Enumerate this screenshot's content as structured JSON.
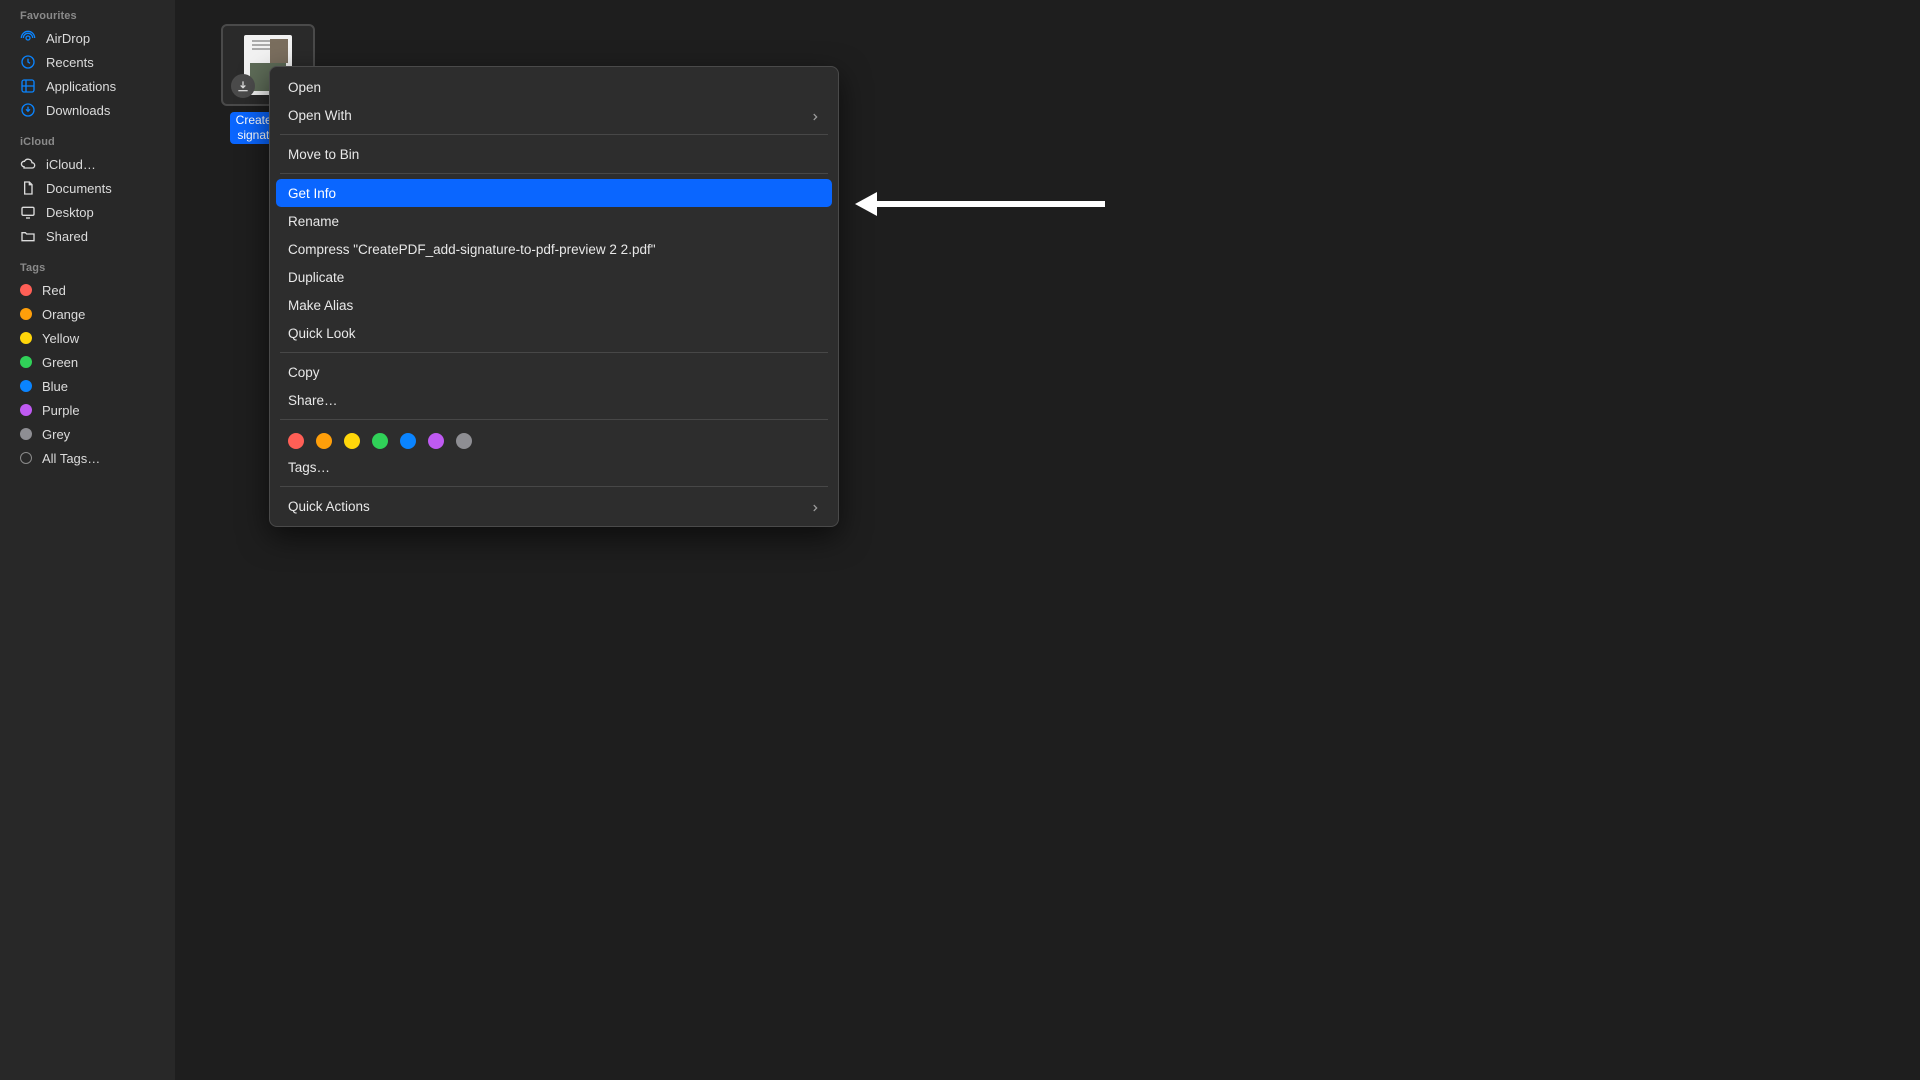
{
  "sidebar": {
    "sections": {
      "favourites": {
        "title": "Favourites",
        "items": [
          {
            "label": "AirDrop"
          },
          {
            "label": "Recents"
          },
          {
            "label": "Applications"
          },
          {
            "label": "Downloads"
          }
        ]
      },
      "icloud": {
        "title": "iCloud",
        "items": [
          {
            "label": "iCloud…"
          },
          {
            "label": "Documents"
          },
          {
            "label": "Desktop"
          },
          {
            "label": "Shared"
          }
        ]
      },
      "tags": {
        "title": "Tags",
        "items": [
          {
            "label": "Red",
            "color": "#ff5f56"
          },
          {
            "label": "Orange",
            "color": "#ff9f0a"
          },
          {
            "label": "Yellow",
            "color": "#ffd60a"
          },
          {
            "label": "Green",
            "color": "#30d158"
          },
          {
            "label": "Blue",
            "color": "#0a84ff"
          },
          {
            "label": "Purple",
            "color": "#bf5af2"
          },
          {
            "label": "Grey",
            "color": "#8e8e93"
          }
        ],
        "all_tags": "All Tags…"
      }
    }
  },
  "file": {
    "name": "CreatePD…\nsignature…"
  },
  "context_menu": {
    "open": "Open",
    "open_with": "Open With",
    "move_to_bin": "Move to Bin",
    "get_info": "Get Info",
    "rename": "Rename",
    "compress": "Compress \"CreatePDF_add-signature-to-pdf-preview 2 2.pdf\"",
    "duplicate": "Duplicate",
    "make_alias": "Make Alias",
    "quick_look": "Quick Look",
    "copy": "Copy",
    "share": "Share…",
    "tags_button": "Tags…",
    "quick_actions": "Quick Actions",
    "tag_colors": [
      "#ff5f56",
      "#ff9f0a",
      "#ffd60a",
      "#30d158",
      "#0a84ff",
      "#bf5af2",
      "#8e8e93"
    ]
  }
}
